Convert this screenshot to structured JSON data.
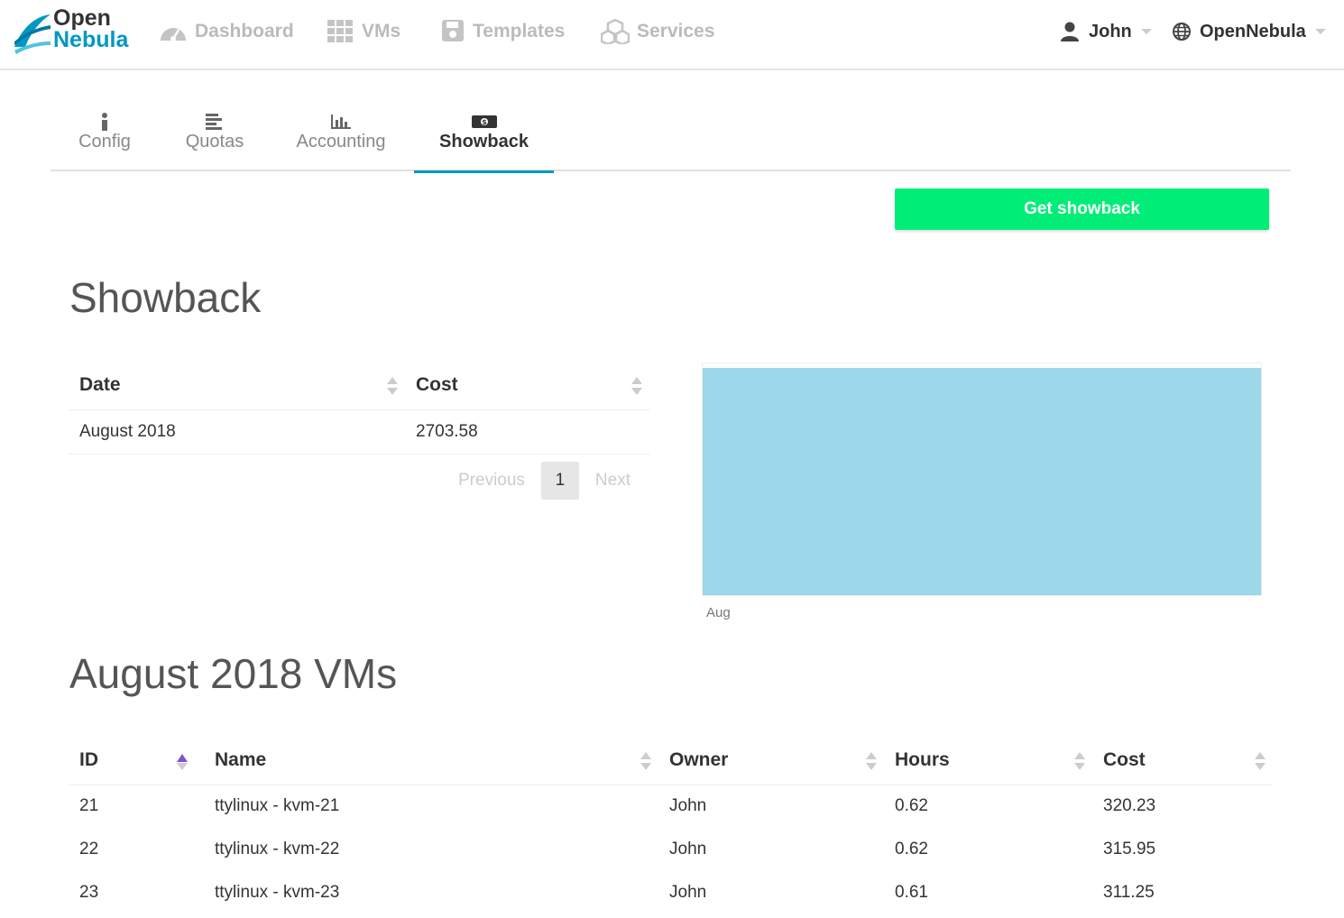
{
  "brand": {
    "line1": "Open",
    "line2": "Nebula"
  },
  "nav": {
    "items": [
      {
        "label": "Dashboard",
        "icon": "dashboard-icon"
      },
      {
        "label": "VMs",
        "icon": "grid-icon"
      },
      {
        "label": "Templates",
        "icon": "save-icon"
      },
      {
        "label": "Services",
        "icon": "cubes-icon"
      }
    ],
    "user": {
      "label": "John",
      "icon": "user-icon"
    },
    "zone": {
      "label": "OpenNebula",
      "icon": "globe-icon"
    }
  },
  "tabs": [
    {
      "label": "Config",
      "icon": "info-icon",
      "active": false
    },
    {
      "label": "Quotas",
      "icon": "align-left-icon",
      "active": false
    },
    {
      "label": "Accounting",
      "icon": "bar-chart-icon",
      "active": false
    },
    {
      "label": "Showback",
      "icon": "money-icon",
      "active": true
    }
  ],
  "actions": {
    "get_showback": "Get showback"
  },
  "showback": {
    "title": "Showback",
    "columns": [
      "Date",
      "Cost"
    ],
    "rows": [
      {
        "date": "August 2018",
        "cost": "2703.58"
      }
    ],
    "pager": {
      "previous": "Previous",
      "page": "1",
      "next": "Next"
    }
  },
  "chart_data": {
    "type": "bar",
    "categories": [
      "Aug"
    ],
    "values": [
      2703.58
    ],
    "title": "",
    "xlabel": "",
    "ylabel": "",
    "colors": [
      "#9bd8ea"
    ],
    "grid": false
  },
  "vms": {
    "title": "August 2018 VMs",
    "columns": [
      "ID",
      "Name",
      "Owner",
      "Hours",
      "Cost"
    ],
    "rows": [
      {
        "id": "21",
        "name": "ttylinux - kvm-21",
        "owner": "John",
        "hours": "0.62",
        "cost": "320.23"
      },
      {
        "id": "22",
        "name": "ttylinux - kvm-22",
        "owner": "John",
        "hours": "0.62",
        "cost": "315.95"
      },
      {
        "id": "23",
        "name": "ttylinux - kvm-23",
        "owner": "John",
        "hours": "0.61",
        "cost": "311.25"
      }
    ]
  },
  "colors": {
    "accent": "#0098c3",
    "button": "#00ee77",
    "sort_active": "#7f50d8",
    "bar": "#9bd8ea"
  }
}
